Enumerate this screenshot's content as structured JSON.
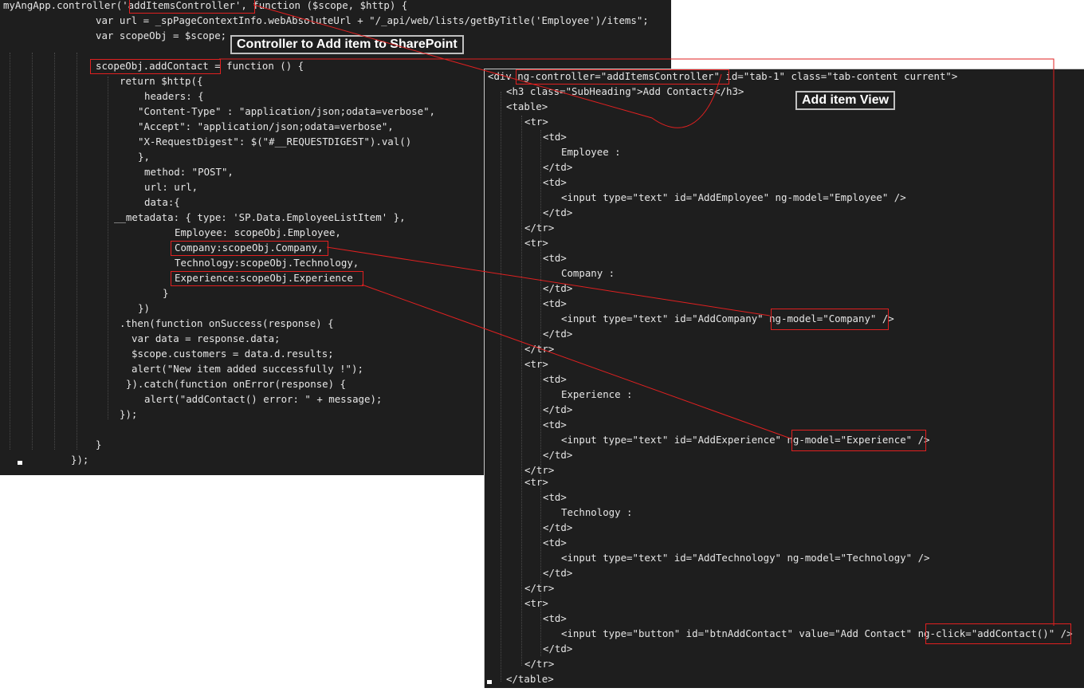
{
  "controller": {
    "caption": "Controller to Add item to SharePoint",
    "lines": [
      "myAngApp.controller('addItemsController', function ($scope, $http) {",
      "var url = _spPageContextInfo.webAbsoluteUrl + \"/_api/web/lists/getByTitle('Employee')/items\";",
      "var scopeObj = $scope;",
      "scopeObj.addContact = function () {",
      "return $http({",
      "headers: {",
      "\"Content-Type\" : \"application/json;odata=verbose\",",
      "\"Accept\": \"application/json;odata=verbose\",",
      "\"X-RequestDigest\": $(\"#__REQUESTDIGEST\").val()",
      "},",
      "method: \"POST\",",
      "url: url,",
      "data:{",
      "__metadata: { type: 'SP.Data.EmployeeListItem' },",
      "Employee: scopeObj.Employee,",
      "Company:scopeObj.Company,",
      "Technology:scopeObj.Technology,",
      "Experience:scopeObj.Experience",
      "}",
      "})",
      ".then(function onSuccess(response) {",
      "var data = response.data;",
      "$scope.customers = data.d.results;",
      "alert(\"New item added successfully !\");",
      "}).catch(function onError(response) {",
      "alert(\"addContact() error: \" + message);",
      "});",
      "}",
      "});"
    ]
  },
  "view": {
    "caption": "Add item View",
    "lines": [
      "<div ng-controller=\"addItemsController\" id=\"tab-1\" class=\"tab-content current\">",
      "<h3 class=\"SubHeading\">Add Contacts</h3>",
      "<table>",
      "<tr>",
      "<td>",
      "Employee :",
      "</td>",
      "<td>",
      "<input type=\"text\" id=\"AddEmployee\" ng-model=\"Employee\" />",
      "</td>",
      "</tr>",
      "<tr>",
      "<td>",
      "Company :",
      "</td>",
      "<td>",
      "<input type=\"text\" id=\"AddCompany\" ng-model=\"Company\" />",
      "</td>",
      "</tr>",
      "<tr>",
      "<td>",
      "Experience :",
      "</td>",
      "<td>",
      "<input type=\"text\" id=\"AddExperience\" ng-model=\"Experience\" />",
      "</td>",
      "</tr>",
      "<tr>",
      "<td>",
      "Technology :",
      "</td>",
      "<td>",
      "<input type=\"text\" id=\"AddTechnology\" ng-model=\"Technology\" />",
      "</td>",
      "</tr>",
      "<tr>",
      "<td>",
      "<input type=\"button\" id=\"btnAddContact\" value=\"Add Contact\" ng-click=\"addContact()\" />",
      "</td>",
      "</tr>",
      "</table>"
    ]
  },
  "colors": {
    "background": "#1e1e1e",
    "text": "#e6e6e6",
    "highlight": "#e02020",
    "caption_border": "#c0c0c0"
  }
}
